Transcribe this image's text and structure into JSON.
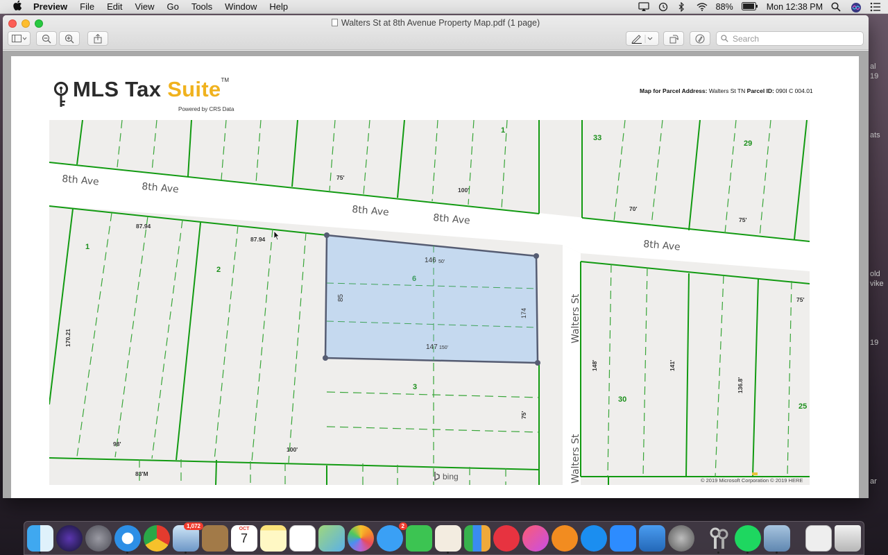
{
  "menubar": {
    "items": [
      "Preview",
      "File",
      "Edit",
      "View",
      "Go",
      "Tools",
      "Window",
      "Help"
    ],
    "battery": "88%",
    "clock": "Mon 12:38 PM"
  },
  "window": {
    "title": "Walters St at 8th Avenue Property Map.pdf (1 page)",
    "search_placeholder": "Search"
  },
  "document": {
    "logo_main": "MLS Tax ",
    "logo_accent": "Suite",
    "logo_tm": "TM",
    "powered_by": "Powered by CRS Data",
    "parcel_label": "Map for Parcel Address:",
    "parcel_address": "Walters St TN",
    "parcel_id_label": "Parcel ID:",
    "parcel_id": "090I C 004.01",
    "map": {
      "street_labels": [
        "8th Ave",
        "8th Ave",
        "8th Ave",
        "8th Ave",
        "8th Ave",
        "Walters St",
        "Walters St"
      ],
      "lot_numbers": [
        "1",
        "33",
        "29",
        "1",
        "2",
        "6",
        "3",
        "30",
        "25"
      ],
      "dimensions": [
        "75'",
        "100'",
        "70'",
        "75'",
        "87.94",
        "87.94",
        "146",
        "50'",
        "85",
        "174",
        "147",
        "150'",
        "170.21",
        "148'",
        "141'",
        "136.8'",
        "75'",
        "75'",
        "98'",
        "100'",
        "83'M"
      ],
      "attribution": "© 2019 Microsoft Corporation © 2019 HERE",
      "bing": "bing"
    }
  },
  "desktop": {
    "edge_texts": [
      "al",
      "19",
      "ats",
      "old",
      "vike",
      "19",
      "ar"
    ]
  },
  "dock": {
    "mail_badge": "1,072",
    "messages_badge": "2",
    "calendar_month": "OCT",
    "calendar_day": "7"
  },
  "colors": {
    "parcel_fill": "#c5d9ef",
    "parcel_stroke": "#555c72",
    "lot_line": "#119a11",
    "logo_accent": "#f0b21e"
  }
}
